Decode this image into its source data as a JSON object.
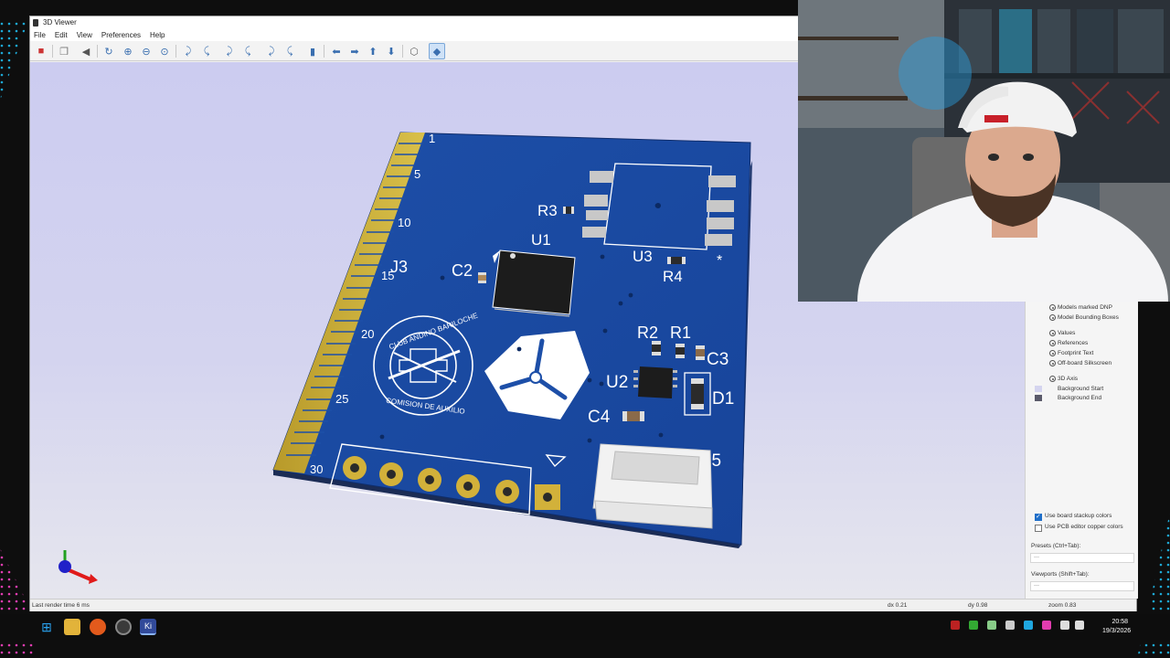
{
  "window": {
    "title": "3D Viewer",
    "menu": [
      "File",
      "Edit",
      "View",
      "Preferences",
      "Help"
    ]
  },
  "toolbar": {
    "icons": [
      "render-icon",
      "copy-icon",
      "raytrace-icon",
      "reload-icon",
      "zoom-in-icon",
      "zoom-out-icon",
      "zoom-fit-icon",
      "rotate-x-cw-icon",
      "rotate-x-ccw-icon",
      "rotate-y-cw-icon",
      "rotate-y-ccw-icon",
      "rotate-z-cw-icon",
      "rotate-z-ccw-icon",
      "flip-board-icon",
      "pan-left-icon",
      "pan-right-icon",
      "pan-up-icon",
      "pan-down-icon",
      "ortho-icon",
      "layers-panel-icon"
    ]
  },
  "board": {
    "pin_numbers": [
      "1",
      "5",
      "10",
      "15",
      "20",
      "25",
      "30"
    ],
    "refs": {
      "r3": "R3",
      "u1": "U1",
      "c2": "C2",
      "j3": "J3",
      "u3": "U3",
      "r4": "R4",
      "r2": "R2",
      "r1": "R1",
      "c3": "C3",
      "u2": "U2",
      "d1": "D1",
      "c4": "C4",
      "j5": "J5",
      "star": "*"
    },
    "logo_text_top": "CLUB ANDINO BARILOCHE",
    "logo_text_bottom": "COMISION DE AUXILIO"
  },
  "layers_panel": {
    "items": [
      {
        "label": "Models marked DNP",
        "swatch": "",
        "eye": true
      },
      {
        "label": "Model Bounding Boxes",
        "swatch": "",
        "eye": true
      },
      {
        "label": "Values",
        "swatch": "",
        "eye": true
      },
      {
        "label": "References",
        "swatch": "",
        "eye": true
      },
      {
        "label": "Footprint Text",
        "swatch": "",
        "eye": true
      },
      {
        "label": "Off-board Silkscreen",
        "swatch": "",
        "eye": true
      },
      {
        "label": "3D Axis",
        "swatch": "",
        "eye": true
      },
      {
        "label": "Background Start",
        "swatch": "#d4d4ef",
        "eye": false
      },
      {
        "label": "Background End",
        "swatch": "#5a5a6a",
        "eye": false
      }
    ],
    "use_board_stackup": "Use board stackup colors",
    "use_board_stackup_checked": true,
    "use_pcb_copper": "Use PCB editor copper colors",
    "use_pcb_copper_checked": false,
    "presets_label": "Presets (Ctrl+Tab):",
    "presets_value": "---",
    "viewports_label": "Viewports (Shift+Tab):",
    "viewports_value": "---"
  },
  "status": {
    "render_time": "Last render time 6 ms",
    "dx": "dx 0.21",
    "dy": "dy 0.98",
    "zoom": "zoom 0.83"
  },
  "taskbar": {
    "apps": [
      "windows-start-icon",
      "file-explorer-icon",
      "firefox-icon",
      "chrome-icon",
      "kicad-icon"
    ],
    "time": "20:58",
    "date": "19/3/2026"
  }
}
